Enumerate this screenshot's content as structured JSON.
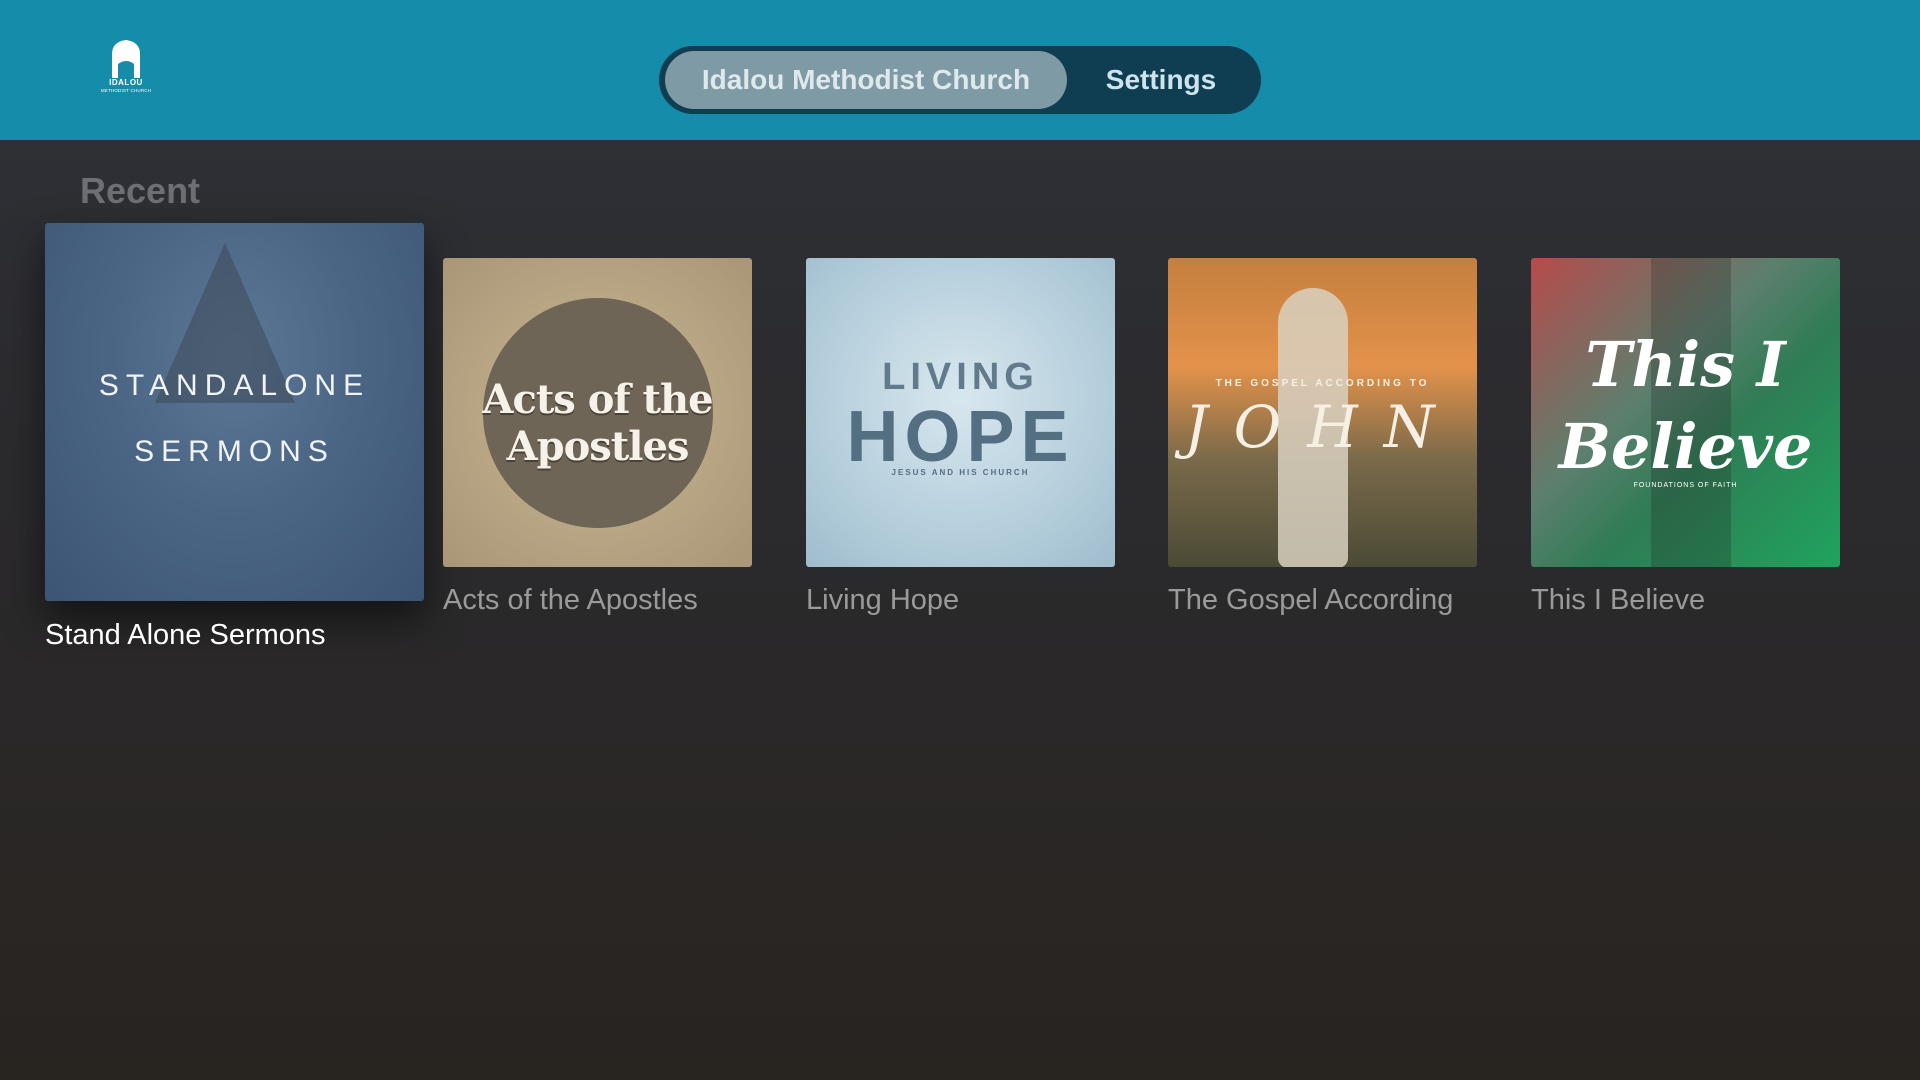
{
  "header": {
    "logo": {
      "icon": "church-icon",
      "line1": "IDALOU",
      "line2": "METHODIST CHURCH"
    },
    "tabs": [
      {
        "label": "Idalou Methodist Church",
        "selected": true
      },
      {
        "label": "Settings",
        "selected": false
      }
    ]
  },
  "main": {
    "section_title": "Recent",
    "items": [
      {
        "caption": "Stand Alone Sermons",
        "art_line1": "STANDALONE",
        "art_line2": "SERMONS",
        "focused": true
      },
      {
        "caption": "Acts of the Apostles",
        "art_title": "Acts of the Apostles"
      },
      {
        "caption": "Living Hope",
        "art_line1": "LIVING",
        "art_line2": "HOPE",
        "art_line3": "JESUS AND HIS CHURCH"
      },
      {
        "caption": "The Gospel According",
        "art_small": "THE GOSPEL ACCORDING TO",
        "art_big": "JOHN"
      },
      {
        "caption": "This I Believe",
        "art_line1": "This I",
        "art_line2": "Believe",
        "art_line3": "FOUNDATIONS OF FAITH"
      }
    ]
  },
  "colors": {
    "header_bg": "#168cab",
    "tab_bar_bg": "#0f3d52",
    "tab_selected_bg": "#7e9aa5",
    "page_bg": "#2c2c2f"
  }
}
